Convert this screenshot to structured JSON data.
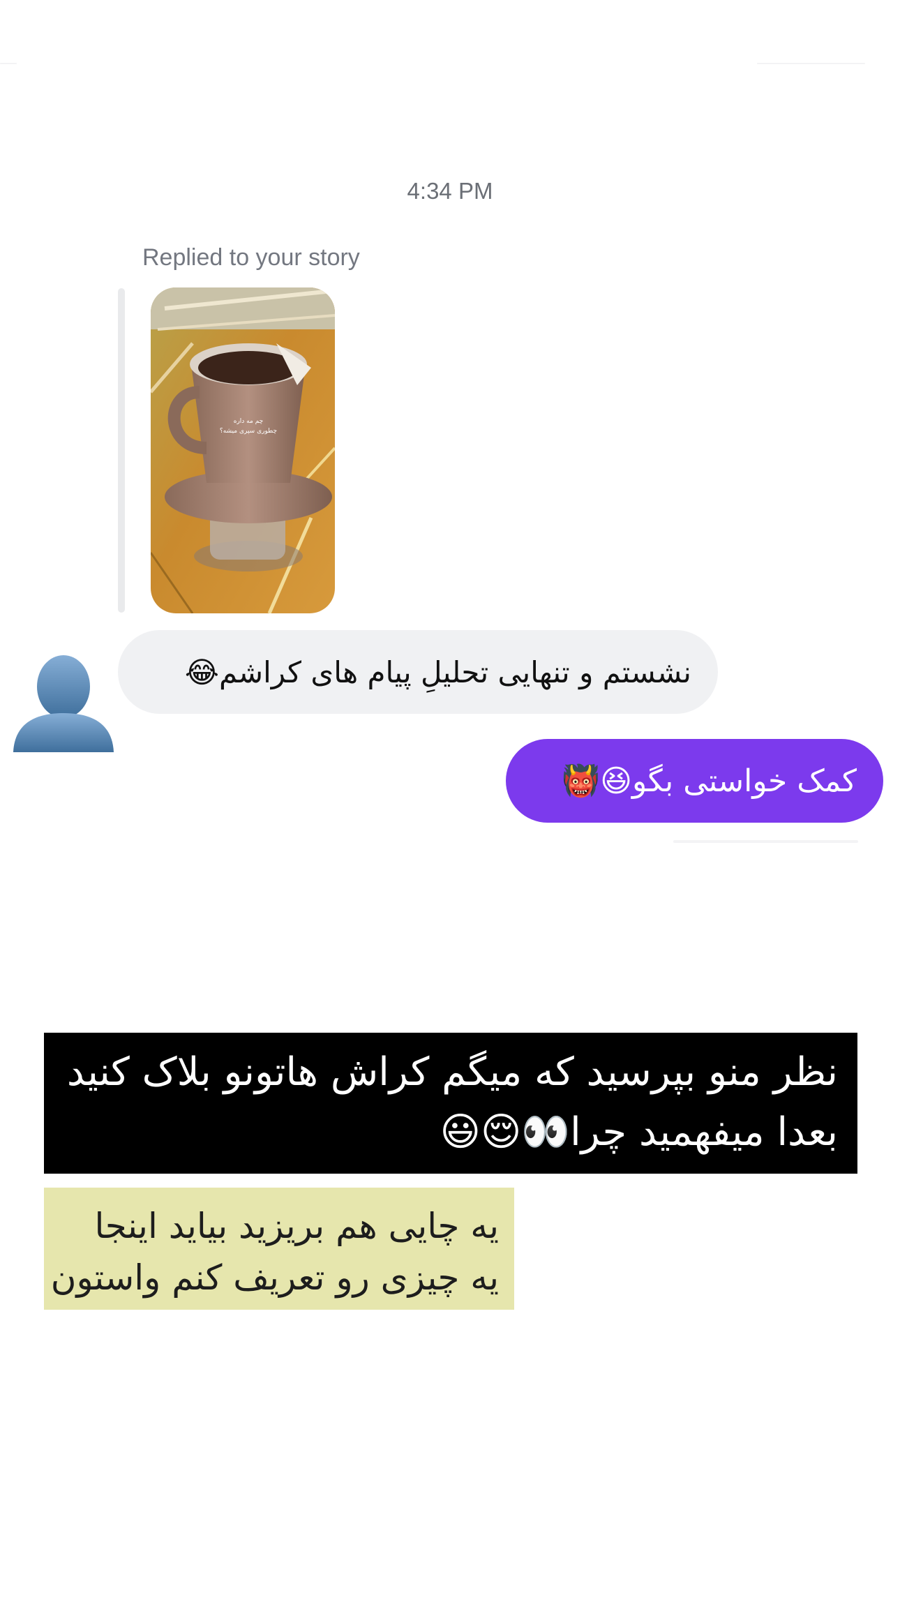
{
  "conversation": {
    "timestamp": "4:34 PM",
    "story_reply": {
      "label": "Replied to your story",
      "story_text_line1": "چم مه داره",
      "story_text_line2": "چطوری سپری میشه؟"
    },
    "messages": [
      {
        "sender": "other",
        "text": "نشستم و تنهایی تحلیلِ پیام های کراشم😂"
      },
      {
        "sender": "me",
        "text": "کمک خواستی بگو😆👹"
      }
    ]
  },
  "overlay_captions": {
    "caption1_line1": "نظر منو بپرسید که میگم کراش هاتونو بلاک کنید",
    "caption1_line2": "بعدا میفهمید چرا👀😌😃",
    "caption2_line1": "یه چایی هم بریزید بیاید اینجا",
    "caption2_line2": "یه چیزی رو تعریف کنم واستون"
  },
  "colors": {
    "outgoing_bubble": "#7c3aed",
    "incoming_bubble": "#f0f1f3",
    "caption1_bg": "#000000",
    "caption2_bg": "#e6e6ad"
  },
  "icons": {
    "avatar": "default-user-silhouette-icon"
  }
}
